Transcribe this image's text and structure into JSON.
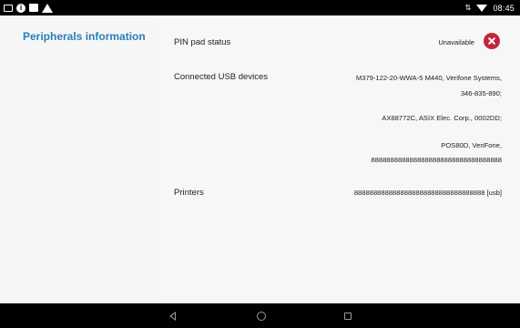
{
  "status_bar": {
    "time": "08:45",
    "left_icons": [
      "notification-box-icon",
      "info-icon",
      "image-icon",
      "warning-icon"
    ],
    "right_icons": [
      "data-arrows-icon",
      "wifi-icon"
    ]
  },
  "sidebar": {
    "title": "Peripherals information"
  },
  "details": {
    "pin_pad": {
      "label": "PIN pad status",
      "value": "Unavailable",
      "icon": "error-icon",
      "icon_color": "#c0283a"
    },
    "usb": {
      "label": "Connected USB devices",
      "devices": [
        {
          "line1": "M379-122-20-WWA-5 M440, Verifone Systems,",
          "line2": "346-835-890;"
        },
        {
          "line1": "AX88772C, ASIX Elec. Corp., 0002DD;"
        },
        {
          "line1": "POS80D, VeriFone,",
          "line2": "8888888888888888888888888888888888"
        }
      ]
    },
    "printers": {
      "label": "Printers",
      "value": "8888888888888888888888888888888888 [usb]"
    }
  },
  "nav_bar": {
    "buttons": [
      "back-icon",
      "home-icon",
      "recents-icon"
    ]
  },
  "colors": {
    "accent": "#2a7fb9",
    "error": "#c0283a",
    "bar": "#000000",
    "background": "#f6f6f6"
  }
}
